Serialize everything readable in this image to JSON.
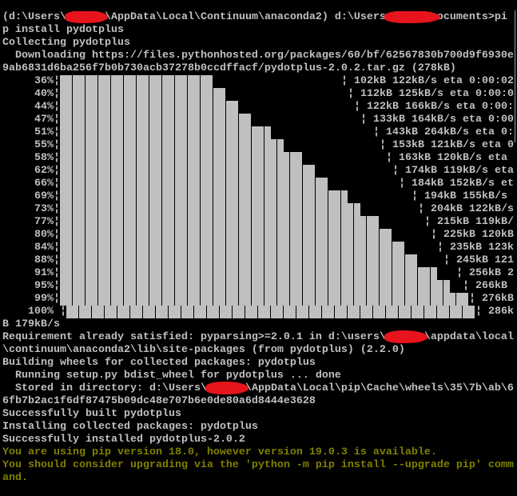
{
  "colors": {
    "text": "#c0c0c0",
    "warning": "#808000",
    "background": "#000000",
    "redaction": "#e8141c"
  },
  "lines_before": {
    "prompt_a": "(d:\\Users\\",
    "prompt_b": "\\AppData\\Local\\Continuum\\anaconda2) d:\\Users",
    "prompt_c": "ocuments>pi",
    "cmd_wrap": "p install pydotplus",
    "collecting": "Collecting pydotplus",
    "downloading": "  Downloading https://files.pythonhosted.org/packages/60/bf/62567830b700d9f6930e",
    "downloading_wrap": "9ab6831d6ba256f7b0b730acb37278b0ccdffacf/pydotplus-2.0.2.tar.gz (278kB)"
  },
  "progress": {
    "separator": "¦",
    "rows": [
      {
        "pct": "36%",
        "stats": "102kB 122kB/s eta 0:00:02"
      },
      {
        "pct": "40%",
        "stats": "112kB 125kB/s eta 0:00:0"
      },
      {
        "pct": "44%",
        "stats": "122kB 166kB/s eta 0:00:"
      },
      {
        "pct": "47%",
        "stats": "133kB 164kB/s eta 0:00"
      },
      {
        "pct": "51%",
        "stats": "143kB 264kB/s eta 0:"
      },
      {
        "pct": "55%",
        "stats": "153kB 121kB/s eta 0"
      },
      {
        "pct": "58%",
        "stats": "163kB 120kB/s eta"
      },
      {
        "pct": "62%",
        "stats": "174kB 119kB/s eta"
      },
      {
        "pct": "66%",
        "stats": "184kB 152kB/s et"
      },
      {
        "pct": "69%",
        "stats": "194kB 155kB/s"
      },
      {
        "pct": "73%",
        "stats": "204kB 122kB/s"
      },
      {
        "pct": "77%",
        "stats": "215kB 119kB/"
      },
      {
        "pct": "80%",
        "stats": "225kB 120kB"
      },
      {
        "pct": "84%",
        "stats": "235kB 123k"
      },
      {
        "pct": "88%",
        "stats": "245kB 121"
      },
      {
        "pct": "91%",
        "stats": "256kB 2"
      },
      {
        "pct": "95%",
        "stats": "266kB"
      },
      {
        "pct": "99%",
        "stats": "276kB"
      },
      {
        "pct": "100%",
        "stats": "286k"
      }
    ]
  },
  "lines_after": {
    "rate_wrap": "B 179kB/s",
    "req_a": "Requirement already satisfied: pyparsing>=2.0.1 in d:\\users\\",
    "req_b": "\\appdata\\local",
    "req_wrap": "\\continuum\\anaconda2\\lib\\site-packages (from pydotplus) (2.2.0)",
    "building": "Building wheels for collected packages: pydotplus",
    "running": "  Running setup.py bdist_wheel for pydotplus ... done",
    "stored_a": "  Stored in directory: d:\\Users\\",
    "stored_b": "\\AppData\\Local\\pip\\Cache\\wheels\\35\\7b\\ab\\6",
    "stored_wrap": "6fb7b2ac1f6df87475b09dc48e707b6e0de80a6d8444e3628",
    "built": "Successfully built pydotplus",
    "installing": "Installing collected packages: pydotplus",
    "installed": "Successfully installed pydotplus-2.0.2",
    "warn1": "You are using pip version 18.0, however version 19.0.3 is available.",
    "warn2": "You should consider upgrading via the 'python -m pip install --upgrade pip' comm",
    "warn2_wrap": "and."
  }
}
